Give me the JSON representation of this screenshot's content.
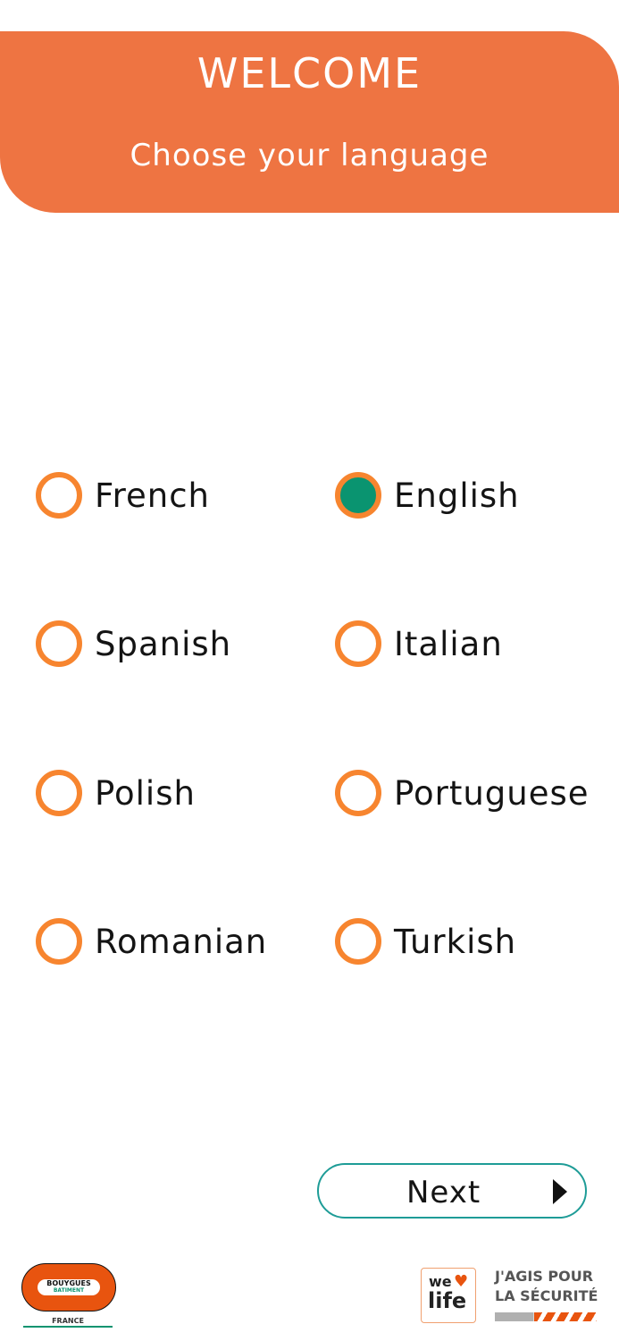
{
  "header": {
    "title": "WELCOME",
    "subtitle": "Choose your language"
  },
  "languages": [
    {
      "label": "French",
      "selected": false
    },
    {
      "label": "English",
      "selected": true
    },
    {
      "label": "Spanish",
      "selected": false
    },
    {
      "label": "Italian",
      "selected": false
    },
    {
      "label": "Polish",
      "selected": false
    },
    {
      "label": "Portuguese",
      "selected": false
    },
    {
      "label": "Romanian",
      "selected": false
    },
    {
      "label": "Turkish",
      "selected": false
    }
  ],
  "next_button": {
    "label": "Next",
    "icon": "play-arrow-icon"
  },
  "footer": {
    "company_logo_line1": "BOUYGUES",
    "company_logo_line2": "BATIMENT",
    "company_country": "FRANCE",
    "welife_we": "we",
    "welife_life": "life",
    "safety_line1": "J'AGIS POUR",
    "safety_line2": "LA SÉCURITÉ"
  },
  "colors": {
    "header_bg": "#ee7442",
    "radio_ring": "#f7852f",
    "radio_selected": "#0a9470",
    "next_border": "#1e9c97"
  }
}
